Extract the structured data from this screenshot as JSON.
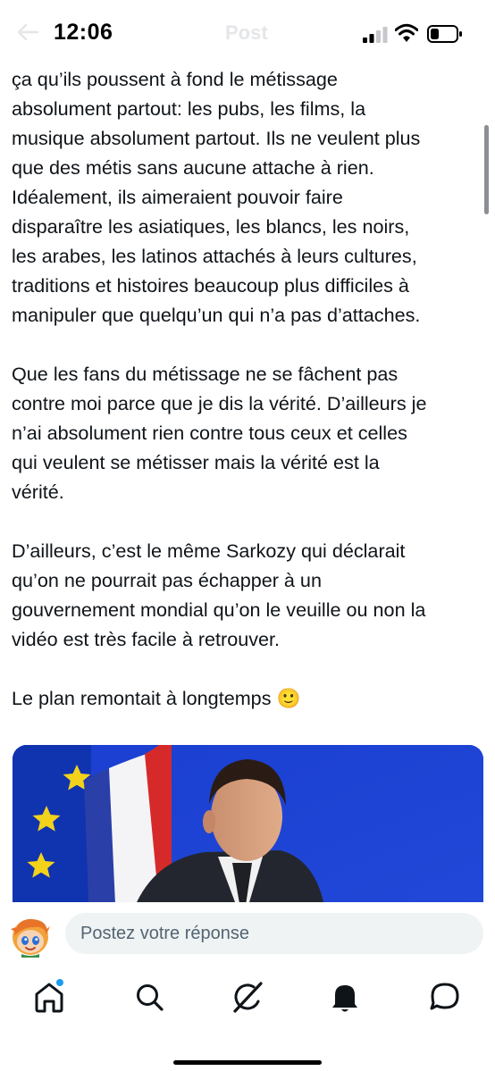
{
  "status_bar": {
    "time": "12:06",
    "ghost_title": "Post",
    "icons": [
      "back-arrow-icon",
      "cellular-signal-icon",
      "wifi-icon",
      "battery-icon"
    ]
  },
  "tweet": {
    "paragraph_1": "ça qu’ils poussent à fond le métissage\nabsolument partout: les pubs, les films, la\nmusique absolument partout. Ils ne veulent plus\nque des métis sans aucune attache à rien.\nIdéalement, ils aimeraient pouvoir faire\ndisparaître les asiatiques, les blancs, les noirs,\nles arabes, les latinos attachés à leurs cultures,\ntraditions et histoires beaucoup plus difficiles à\nmanipuler que quelqu’un qui n’a pas d’attaches.",
    "paragraph_2": "Que les fans du métissage ne se fâchent pas\ncontre moi parce que je dis la vérité. D’ailleurs je\nn’ai absolument rien contre tous ceux et celles\nqui veulent se métisser mais la vérité est la\nvérité.",
    "paragraph_3": "D’ailleurs, c’est le même Sarkozy qui déclarait\nqu’on ne pourrait pas échapper à un\ngouvernement mondial qu’on le veuille ou non la\nvidéo est très facile à retrouver.",
    "paragraph_4": "Le plan remontait à longtemps 🙂",
    "media": "video-thumbnail"
  },
  "reply": {
    "placeholder": "Postez votre réponse",
    "avatar": "avatar-icon"
  },
  "tabs": [
    {
      "name": "home-icon",
      "has_notification_dot": true
    },
    {
      "name": "search-icon"
    },
    {
      "name": "grok-icon"
    },
    {
      "name": "notifications-icon"
    },
    {
      "name": "messages-icon"
    }
  ],
  "colors": {
    "text": "#0f1419",
    "muted": "#536471",
    "accent": "#1d9bf0",
    "input_bg": "#eff3f4"
  }
}
